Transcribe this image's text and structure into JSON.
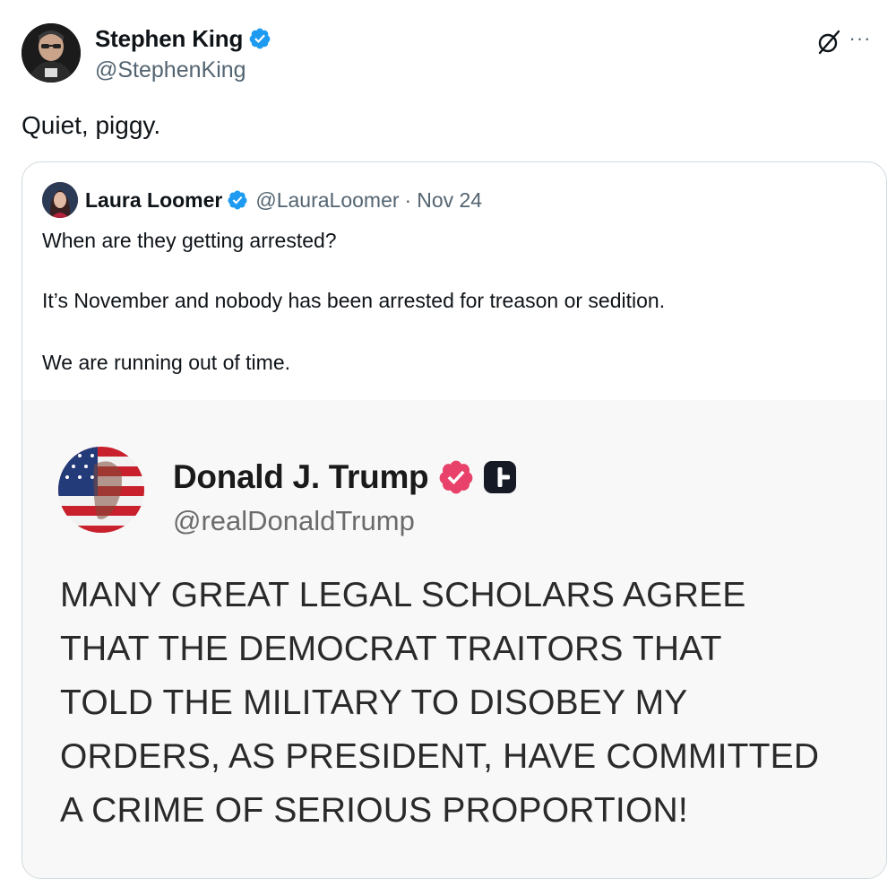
{
  "post": {
    "author": {
      "display_name": "Stephen King",
      "handle": "@StephenKing",
      "verified": true
    },
    "text": "Quiet, piggy.",
    "icons": {
      "grok": "grok-icon",
      "more": "more-icon",
      "more_glyph": "···"
    }
  },
  "quoted": {
    "author": {
      "display_name": "Laura Loomer",
      "handle": "@LauraLoomer",
      "verified": true
    },
    "separator": "·",
    "date": "Nov 24",
    "lines": [
      "When are they getting arrested?",
      "It’s November and nobody has been arrested for treason or sedition.",
      "We are running out of time."
    ],
    "embedded_post": {
      "author": {
        "display_name": "Donald J. Trump",
        "handle": "@realDonaldTrump"
      },
      "lines": [
        "MANY GREAT LEGAL SCHOLARS AGREE",
        "THAT THE DEMOCRAT TRAITORS THAT",
        "TOLD THE MILITARY TO DISOBEY MY",
        "ORDERS, AS PRESIDENT, HAVE COMMITTED",
        "A CRIME OF SERIOUS PROPORTION!"
      ]
    }
  },
  "colors": {
    "verified_blue": "#1d9bf0",
    "truth_verified_pink": "#e8426a",
    "text_primary": "#0f1419",
    "text_secondary": "#536471",
    "border": "#cfd9de"
  }
}
